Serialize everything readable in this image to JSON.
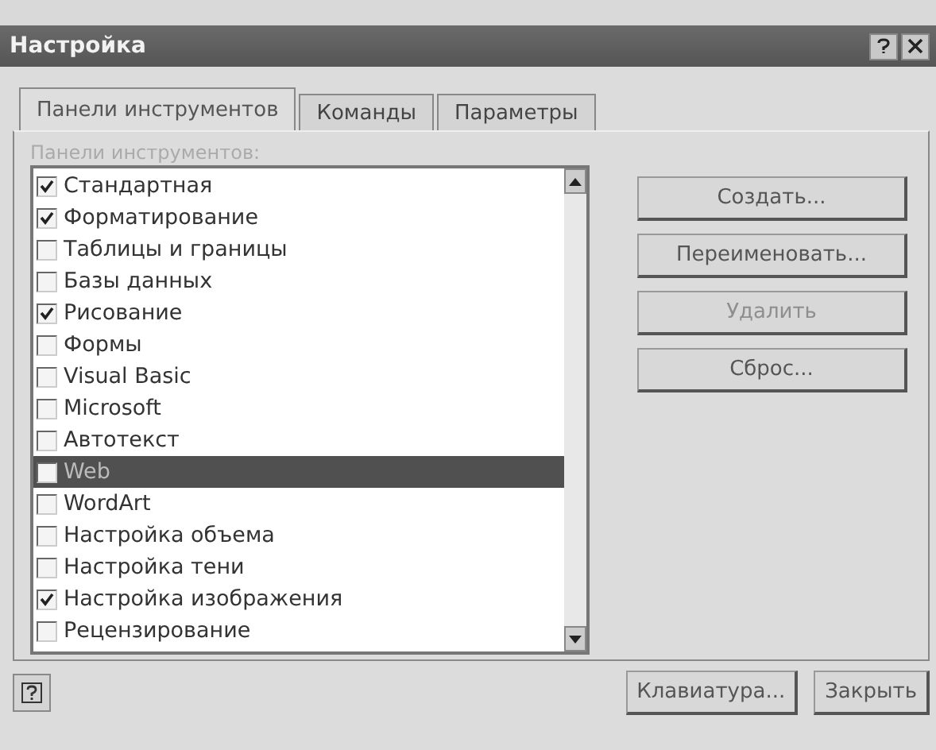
{
  "window": {
    "title": "Настройка"
  },
  "tabs": [
    {
      "label": "Панели инструментов",
      "selected": true
    },
    {
      "label": "Команды",
      "selected": false
    },
    {
      "label": "Параметры",
      "selected": false
    }
  ],
  "list_label": "Панели инструментов:",
  "toolbars": [
    {
      "label": "Стандартная",
      "checked": true,
      "selected": false
    },
    {
      "label": "Форматирование",
      "checked": true,
      "selected": false
    },
    {
      "label": "Таблицы и границы",
      "checked": false,
      "selected": false
    },
    {
      "label": "Базы данных",
      "checked": false,
      "selected": false
    },
    {
      "label": "Рисование",
      "checked": true,
      "selected": false
    },
    {
      "label": "Формы",
      "checked": false,
      "selected": false
    },
    {
      "label": "Visual Basic",
      "checked": false,
      "selected": false
    },
    {
      "label": "Microsoft",
      "checked": false,
      "selected": false
    },
    {
      "label": "Автотекст",
      "checked": false,
      "selected": false
    },
    {
      "label": "Web",
      "checked": false,
      "selected": true
    },
    {
      "label": "WordArt",
      "checked": false,
      "selected": false
    },
    {
      "label": "Настройка объема",
      "checked": false,
      "selected": false
    },
    {
      "label": "Настройка тени",
      "checked": false,
      "selected": false
    },
    {
      "label": "Настройка изображения",
      "checked": true,
      "selected": false
    },
    {
      "label": "Рецензирование",
      "checked": false,
      "selected": false
    }
  ],
  "side_buttons": [
    {
      "label": "Создать...",
      "disabled": false
    },
    {
      "label": "Переименовать...",
      "disabled": false
    },
    {
      "label": "Удалить",
      "disabled": true
    },
    {
      "label": "Сброс...",
      "disabled": false
    }
  ],
  "bottom_buttons": [
    "Клавиатура...",
    "Закрыть"
  ]
}
